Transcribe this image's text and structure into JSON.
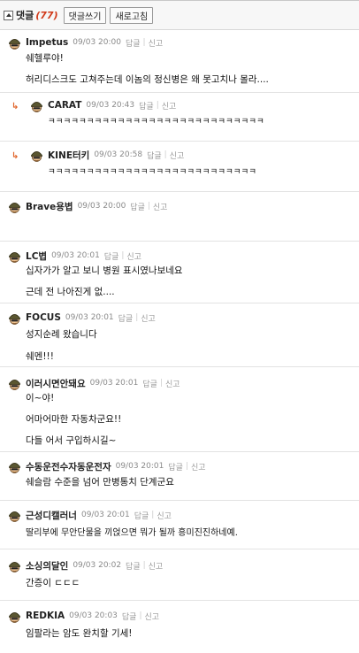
{
  "header": {
    "title": "댓글",
    "count": "(77)",
    "write_button": "댓글쓰기",
    "refresh_button": "새로고침"
  },
  "actions": {
    "reply": "답글",
    "report": "신고"
  },
  "comments": [
    {
      "author": "Impetus",
      "time": "09/03 20:00",
      "lines": [
        "쉐헬루야!",
        "허리디스크도 고쳐주는데 이놈의 정신병은 왜 못고치나 몰라...."
      ]
    },
    {
      "author": "CARAT",
      "time": "09/03 20:43",
      "lines": [
        "ㅋㅋㅋㅋㅋㅋㅋㅋㅋㅋㅋㅋㅋㅋㅋㅋㅋㅋㅋㅋㅋㅋㅋㅋㅋㅋㅋㅋ"
      ]
    },
    {
      "author": "KINE터키",
      "time": "09/03 20:58",
      "lines": [
        "ㅋㅋㅋㅋㅋㅋㅋㅋㅋㅋㅋㅋㅋㅋㅋㅋㅋㅋㅋㅋㅋㅋㅋㅋㅋㅋㅋ"
      ]
    },
    {
      "author": "Brave용볍",
      "time": "09/03 20:00",
      "lines": []
    },
    {
      "author": "LC볍",
      "time": "09/03 20:01",
      "lines": [
        "십자가가 알고 보니 병원 표시였나보네요",
        "근데 전 나아진게 없...."
      ]
    },
    {
      "author": "FOCUS",
      "time": "09/03 20:01",
      "lines": [
        "성지순례 왔습니다",
        "쉐멘!!!"
      ]
    },
    {
      "author": "이러시면안돼요",
      "time": "09/03 20:01",
      "lines": [
        "이~야!",
        "어마어마한 자동차군요!!",
        "다들 어서 구입하시길~"
      ]
    },
    {
      "author": "수동운전수자동운전자",
      "time": "09/03 20:01",
      "lines": [
        "쉐슬람 수준을 넘어 만병통치 단계군요"
      ]
    },
    {
      "author": "근성디캘러너",
      "time": "09/03 20:01",
      "lines": [
        "딸리부에 무안단물을 끼얹으면 뭐가 될까 흥미진진하네예."
      ]
    },
    {
      "author": "소싱의달인",
      "time": "09/03 20:02",
      "lines": [
        "간증이 ㄷㄷㄷ"
      ]
    },
    {
      "author": "REDKIA",
      "time": "09/03 20:03",
      "lines": [
        "임팔라는 암도 완치할 기세!"
      ]
    }
  ],
  "colors": {
    "count_red": "#d03a1a",
    "reply_arrow": "#e0642a",
    "muted": "#8a8a8a"
  },
  "icons": {
    "avatar": "soldier-helmet-avatar-icon",
    "reply_marker": "reply-arrow-icon",
    "collapse": "collapse-toggle-icon"
  }
}
